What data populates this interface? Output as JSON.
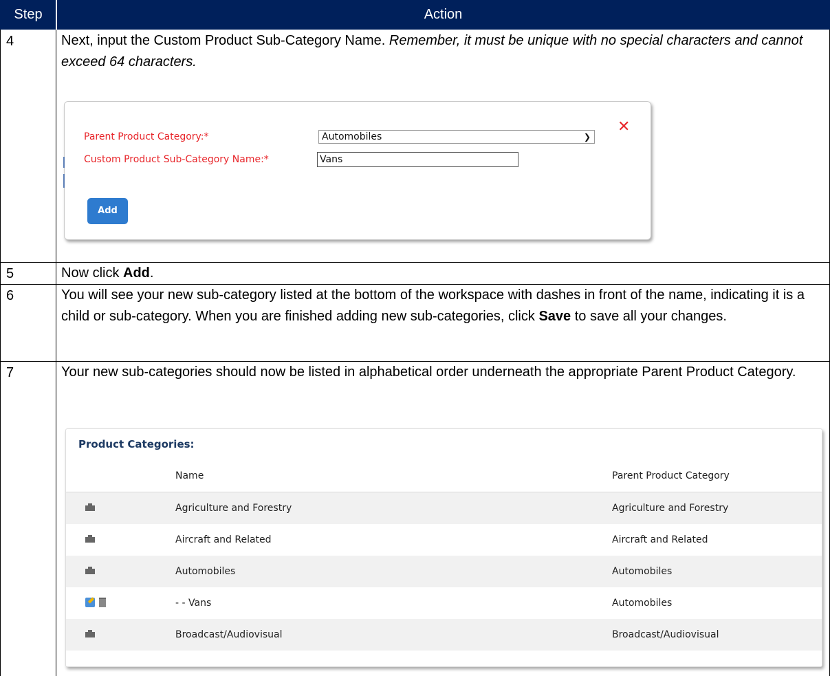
{
  "header": {
    "step": "Step",
    "action": "Action"
  },
  "rows": [
    {
      "step": "4",
      "text_plain": "Next, input the Custom Product Sub-Category Name. ",
      "text_italic": "Remember, it must be unique with no special characters and cannot exceed 64 characters."
    },
    {
      "step": "5",
      "text_pre": "Now click ",
      "text_bold": "Add",
      "text_post": "."
    },
    {
      "step": "6",
      "text_pre": "You will see your new sub-category listed at the bottom of the workspace with dashes in front of the name, indicating it is a child or sub-category. When you are finished adding new sub-categories, click ",
      "text_bold": "Save",
      "text_post": " to save all your changes."
    },
    {
      "step": "7",
      "text": "Your new sub-categories should now be listed in alphabetical order underneath the appropriate Parent Product Category."
    }
  ],
  "dialog": {
    "parent_label": "Parent Product Category:*",
    "parent_value": "Automobiles",
    "name_label": "Custom Product Sub-Category Name:*",
    "name_value": "Vans",
    "close_symbol": "✕",
    "add_label": "Add"
  },
  "categories": {
    "title": "Product Categories:",
    "columns": {
      "name": "Name",
      "parent": "Parent Product Category"
    },
    "items": [
      {
        "icon": "building-icon",
        "name": "Agriculture and Forestry",
        "parent": "Agriculture and Forestry"
      },
      {
        "icon": "building-icon",
        "name": "Aircraft and Related",
        "parent": "Aircraft and Related"
      },
      {
        "icon": "building-icon",
        "name": "Automobiles",
        "parent": "Automobiles"
      },
      {
        "icon": "edit-delete-icons",
        "name": "- - Vans",
        "parent": "Automobiles"
      },
      {
        "icon": "building-icon",
        "name": "Broadcast/Audiovisual",
        "parent": "Broadcast/Audiovisual"
      }
    ]
  },
  "colors": {
    "header_bg": "#00205b",
    "required_label": "#e8262b",
    "add_button": "#2e7bcf",
    "panel_title": "#1d3a63"
  }
}
